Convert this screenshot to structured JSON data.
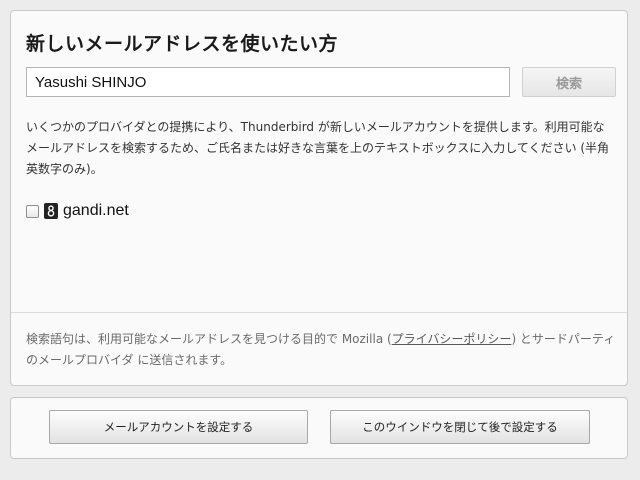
{
  "main": {
    "title": "新しいメールアドレスを使いたい方",
    "name_input": {
      "value": "Yasushi SHINJO",
      "placeholder": ""
    },
    "search_label": "検索",
    "description": "いくつかのプロバイダとの提携により、Thunderbird が新しいメールアカウントを提供します。利用可能なメールアドレスを検索するため、ご氏名または好きな言葉を上のテキストボックスに入力してください (半角英数字のみ)。",
    "providers": [
      {
        "label": "gandi.net",
        "checked": false,
        "icon": "gandi-logo-icon"
      }
    ],
    "privacy": {
      "before": "検索語句は、利用可能なメールアドレスを見つける目的で Mozilla (",
      "link": "プライバシーポリシー",
      "after": ") とサードパーティのメールプロバイダ に送信されます。"
    }
  },
  "footer": {
    "setup_label": "メールアカウントを設定する",
    "close_label": "このウインドウを閉じて後で設定する"
  }
}
